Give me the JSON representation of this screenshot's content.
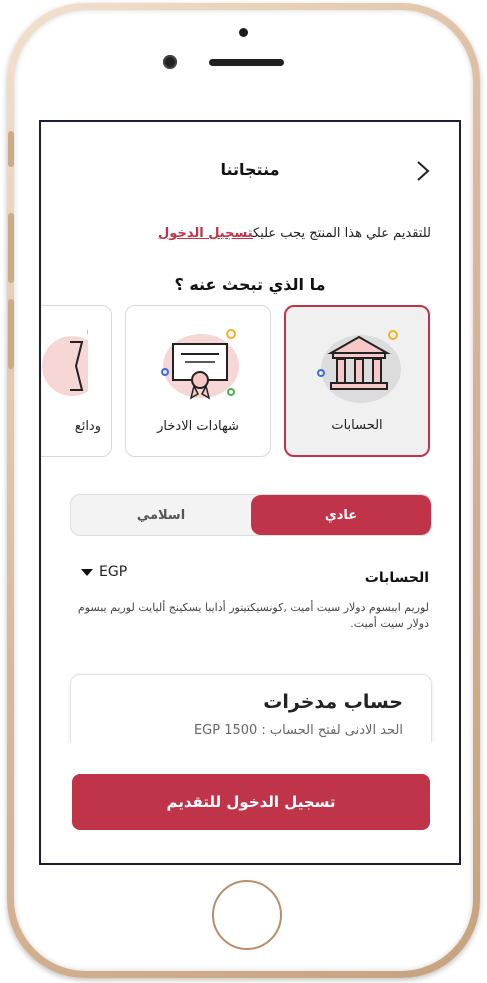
{
  "header": {
    "title": "منتجاتنا"
  },
  "intro": {
    "text": "للتقديم علي هذا المنتج يجب عليك",
    "login_link": "تسجيل الدخول"
  },
  "question": "ما الذي تبحث عنه ؟",
  "product_cards": [
    {
      "label": "الحسابات",
      "icon": "bank-building-icon",
      "selected": true
    },
    {
      "label": "شهادات الادخار",
      "icon": "certificate-icon",
      "selected": false
    },
    {
      "label": "ودائع",
      "icon": "deposits-icon",
      "selected": false
    }
  ],
  "toggle": {
    "active": "عادي",
    "inactive": "اسلامي"
  },
  "section": {
    "title": "الحسابات",
    "currency": "EGP",
    "description": "لوريم ايبسوم دولار سيت أميت ,كونسيكتيتور أدايبا يسكينج أليايت لوريم  يبسوم دولار سيت أميت."
  },
  "account": {
    "title": "حساب مدخرات",
    "min_label": "الحد الادنى لفتح الحساب : EGP 1500"
  },
  "cta": {
    "label": "تسجيل الدخول للتقديم"
  },
  "colors": {
    "accent": "#c0344a",
    "frame": "#d9b99a"
  }
}
